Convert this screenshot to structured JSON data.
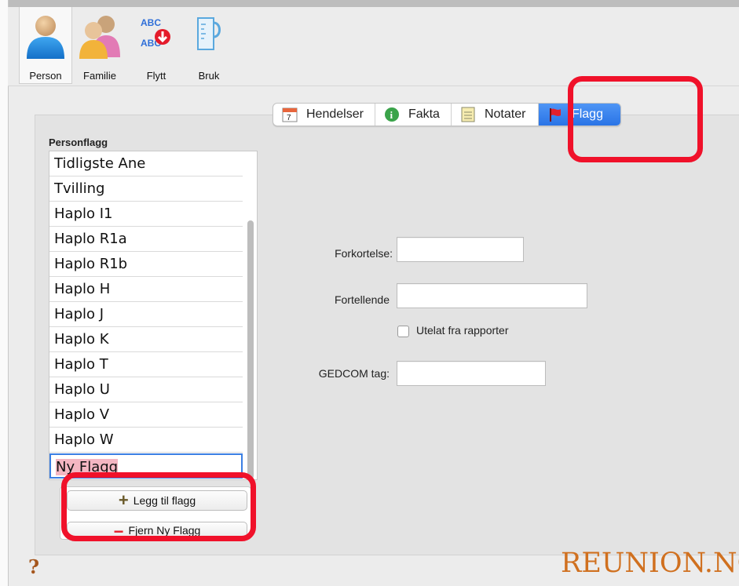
{
  "toolbar": {
    "items": [
      {
        "label": "Person",
        "icon": "person-icon",
        "selected": true
      },
      {
        "label": "Familie",
        "icon": "family-icon",
        "selected": false
      },
      {
        "label": "Flytt",
        "icon": "move-abc-icon",
        "badge_text": "ABC",
        "selected": false
      },
      {
        "label": "Bruk",
        "icon": "measuring-jug-icon",
        "selected": false
      }
    ]
  },
  "tabs": [
    {
      "label": "Hendelser",
      "icon": "calendar-icon",
      "icon_text": "7",
      "active": false
    },
    {
      "label": "Fakta",
      "icon": "info-icon",
      "icon_text": "i",
      "active": false
    },
    {
      "label": "Notater",
      "icon": "notepad-icon",
      "active": false
    },
    {
      "label": "Flagg",
      "icon": "red-flag-icon",
      "active": true
    }
  ],
  "flags_panel": {
    "title": "Personflagg",
    "items": [
      "Tidligste Ane",
      "Tvilling",
      "Haplo I1",
      "Haplo R1a",
      "Haplo R1b",
      "Haplo H",
      "Haplo J",
      "Haplo K",
      "Haplo T",
      "Haplo U",
      "Haplo V",
      "Haplo W",
      "Ny Flagg"
    ],
    "editing_item": "Ny Flagg",
    "add_button": "Legg til flagg",
    "remove_button": "Fjern Ny Flagg"
  },
  "form": {
    "abbrev_label": "Forkortelse:",
    "abbrev_value": "",
    "narrative_label": "Fortellende",
    "narrative_value": "",
    "exclude_label": "Utelat fra rapporter",
    "exclude_checked": false,
    "gedcom_label": "GEDCOM tag:",
    "gedcom_value": ""
  },
  "footer": {
    "help": "?",
    "brand": "REUNION.NO"
  },
  "colors": {
    "annotation_red": "#f0112a",
    "active_tab_blue": "#2a74e6",
    "brand_orange": "#d0701f"
  }
}
